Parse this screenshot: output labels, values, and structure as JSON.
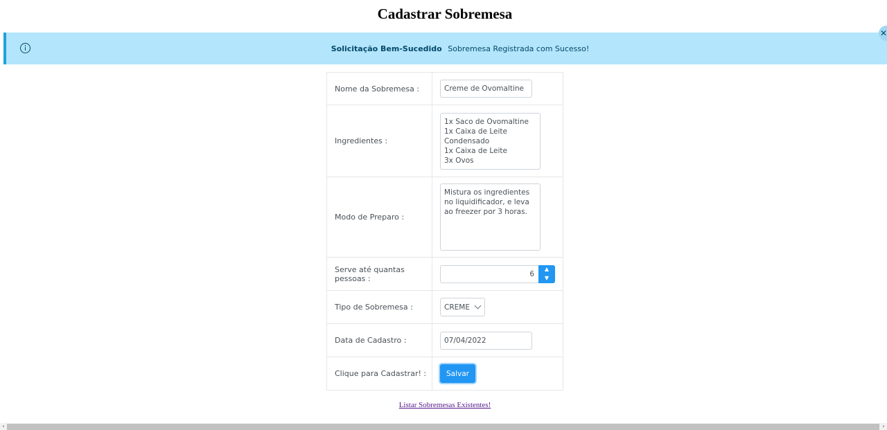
{
  "page": {
    "title": "Cadastrar Sobremesa"
  },
  "alert": {
    "summary": "Solicitação Bem-Sucedido",
    "detail": "Sobremesa Registrada com Sucesso!",
    "info_icon": "info-icon",
    "close_icon": "close-icon",
    "close_glyph": "✕"
  },
  "form": {
    "nome": {
      "label": "Nome da Sobremesa :",
      "value": "Creme de Ovomaltine"
    },
    "ingredientes": {
      "label": "Ingredientes :",
      "value": "1x Saco de Ovomaltine\n1x Caixa de Leite Condensado\n1x Caixa de Leite\n3x Ovos"
    },
    "preparo": {
      "label": "Modo de Preparo :",
      "value": "Mistura os ingredientes no liquidificador, e leva ao freezer por 3 horas."
    },
    "pessoas": {
      "label": "Serve até quantas pessoas :",
      "value": "6",
      "up_glyph": "▲",
      "down_glyph": "▼"
    },
    "tipo": {
      "label": "Tipo de Sobremesa :",
      "value": "CREME"
    },
    "data": {
      "label": "Data de Cadastro :",
      "value": "07/04/2022"
    },
    "cadastrar": {
      "label": "Clique para Cadastrar! :",
      "button": "Salvar"
    }
  },
  "link": {
    "text": "Listar Sobremesas Existentes!"
  },
  "scrollbar": {
    "left_glyph": "‹",
    "right_glyph": "›"
  },
  "colors": {
    "primary": "#2196f3",
    "alert_bg": "#b3e5fc",
    "alert_text": "#044868",
    "link": "#551a8b"
  }
}
